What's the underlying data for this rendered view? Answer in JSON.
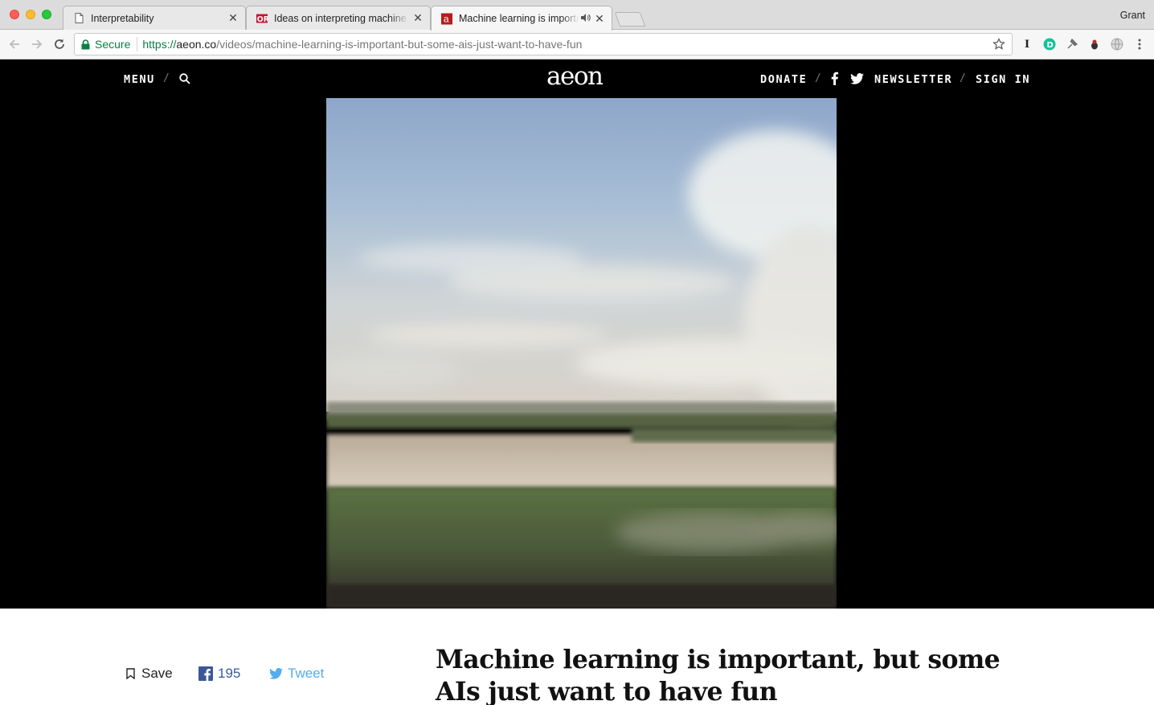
{
  "browser": {
    "tabs": [
      {
        "title": "Interpretability",
        "favicon": "document-icon"
      },
      {
        "title": "Ideas on interpreting machine learning",
        "favicon": "oreilly-favicon"
      },
      {
        "title": "Machine learning is important, but some AIs just want to have fun",
        "favicon": "aeon-favicon",
        "audio": true
      }
    ],
    "profile_name": "Grant",
    "secure_label": "Secure",
    "url": {
      "scheme": "https://",
      "host": "aeon.co",
      "path": "/videos/machine-learning-is-important-but-some-ais-just-want-to-have-fun"
    },
    "extension_icons": [
      "instapaper-icon",
      "grammarly-icon",
      "pin-icon",
      "bug-icon",
      "globe-icon"
    ]
  },
  "site": {
    "nav": {
      "menu_label": "MENU",
      "logo_text": "aeon",
      "donate_label": "DONATE",
      "newsletter_label": "NEWSLETTER",
      "signin_label": "SIGN IN"
    },
    "colors": {
      "background": "#000000",
      "accent_twitter": "#55acee",
      "accent_facebook": "#3b5998"
    },
    "share": {
      "save_label": "Save",
      "facebook_count": "195",
      "tweet_label": "Tweet"
    },
    "article": {
      "headline": "Machine learning is important, but some AIs just want to have fun"
    }
  }
}
